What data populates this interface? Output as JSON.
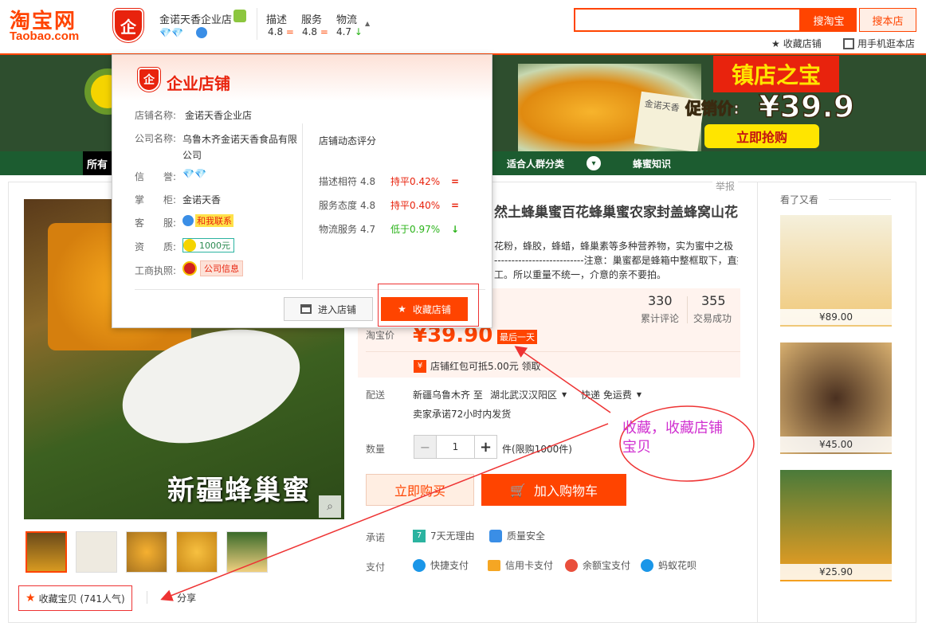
{
  "site": {
    "logo_cn": "淘宝网",
    "logo_en": "Taobao.com"
  },
  "shop": {
    "name": "金诺天香企业店",
    "scores_labels": [
      "描述",
      "服务",
      "物流"
    ],
    "scores_values": [
      "4.8",
      "4.8",
      "4.7"
    ]
  },
  "search": {
    "button": "搜淘宝",
    "button2": "搜本店",
    "fav_shop": "收藏店铺",
    "mobile": "用手机逛本店"
  },
  "banner": {
    "title": "镇店之宝",
    "promo": "促销价:",
    "price": "¥39.9",
    "cta": "立即抢购",
    "pkg_text": "金诺天香"
  },
  "nav": {
    "all": "所有",
    "items": [
      "适合人群分类",
      "蜂蜜知识"
    ]
  },
  "popup": {
    "title": "企业店铺",
    "shop_label": "店铺名称:",
    "shop_value": "金诺天香企业店",
    "company_label": "公司名称:",
    "company_value": "乌鲁木齐金诺天香食品有限公司",
    "credit_label": "信　　誉:",
    "keeper_label": "掌　　柜:",
    "keeper_value": "金诺天香",
    "service_label": "客　　服:",
    "service_value": "和我联系",
    "qual_label": "资　　质:",
    "qual_value": "1000元",
    "license_label": "工商执照:",
    "license_value": "公司信息",
    "rating_title": "店铺动态评分",
    "ratings": [
      {
        "label": "描述相符",
        "score": "4.8",
        "cmp": "持平0.42%",
        "mark": "="
      },
      {
        "label": "服务态度",
        "score": "4.8",
        "cmp": "持平0.40%",
        "mark": "="
      },
      {
        "label": "物流服务",
        "score": "4.7",
        "cmp": "低于0.97%",
        "mark": "↓"
      }
    ],
    "enter_btn": "进入店铺",
    "fav_btn": "收藏店铺"
  },
  "product": {
    "title": "然土蜂巢蜜百花蜂巢蜜农家封盖蜂窝山花",
    "desc1": "花粉，蜂胶，蜂蜡，蜂巢素等多种营养物，实为蜜中之极",
    "desc2": "--------------------------注意：巢蜜都是蜂箱中整框取下，直接装",
    "desc3": "工。所以重量不统一，介意的亲不要拍。",
    "report": "举报",
    "reviews_count": "330",
    "reviews_label": "累计评论",
    "sales_count": "355",
    "sales_label": "交易成功",
    "price_label": "淘宝价",
    "price": "¥39.90",
    "price_tag": "最后一天",
    "coupon": "店铺红包可抵5.00元 领取",
    "ship_label": "配送",
    "ship_from": "新疆乌鲁木齐 至",
    "ship_to": "湖北武汉汉阳区",
    "ship_mode": "快递 免运费",
    "ship_promise": "卖家承诺72小时内发货",
    "qty_label": "数量",
    "qty": "1",
    "qty_limit": "件(限购1000件)",
    "buy_now": "立即购买",
    "add_cart": "加入购物车",
    "promise_label": "承诺",
    "promise_items": [
      "7天无理由",
      "质量安全"
    ],
    "pay_label": "支付",
    "pay_items": [
      "快捷支付",
      "信用卡支付",
      "余额宝支付",
      "蚂蚁花呗"
    ],
    "image_caption": "新疆蜂巢蜜",
    "fav_item": "收藏宝贝 (741人气)",
    "share": "分享"
  },
  "side": {
    "title": "看了又看",
    "prices": [
      "¥89.00",
      "¥45.00",
      "¥25.90"
    ]
  },
  "annotation": {
    "text1": "收藏，收藏店铺",
    "text2": "宝贝"
  }
}
